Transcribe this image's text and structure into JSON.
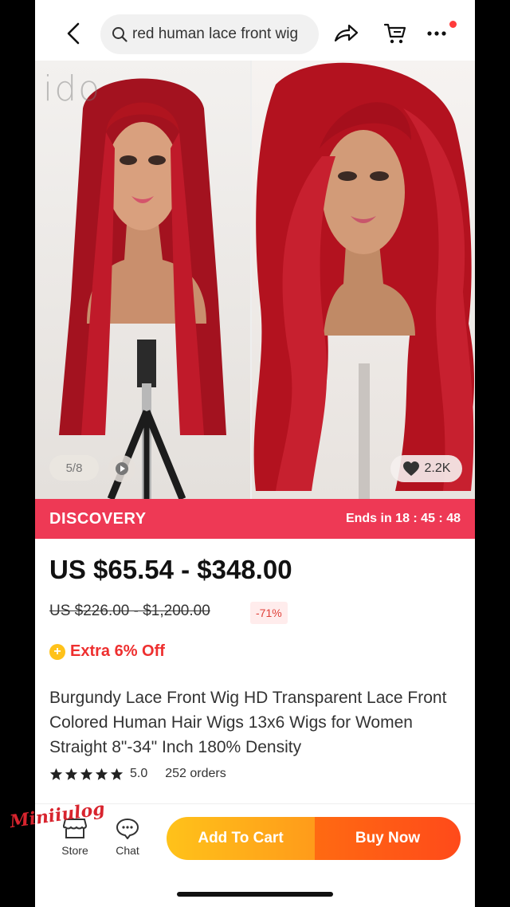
{
  "header": {
    "search_query": "red human lace front wig",
    "icons": [
      "back-icon",
      "search-icon",
      "share-icon",
      "cart-icon",
      "more-icon"
    ]
  },
  "gallery": {
    "counter": "5/8",
    "likes": "2.2K",
    "left_logo": "ido"
  },
  "promo": {
    "title": "DISCOVERY",
    "timer": "Ends in 18 : 45 : 48",
    "color": "#ee3955"
  },
  "product": {
    "price": "US $65.54 - $348.00",
    "original_price": "US $226.00 - $1,200.00",
    "discount": "-71%",
    "extra_offer": "Extra 6% Off",
    "title": "Burgundy Lace Front Wig HD Transparent Lace Front Colored Human Hair Wigs 13x6  Wigs for Women Straight 8\"-34\" Inch 180% Density",
    "rating": 5.0,
    "rating_text": "5.0",
    "orders": "252 orders"
  },
  "bottom_bar": {
    "store_label": "Store",
    "chat_label": "Chat",
    "add_to_cart": "Add To Cart",
    "buy_now": "Buy Now"
  },
  "watermark": "Miniiulog",
  "colors": {
    "accent_red": "#ee2f2f",
    "cart_yellow": "#ffc21a",
    "buy_orange": "#ff5a14"
  }
}
